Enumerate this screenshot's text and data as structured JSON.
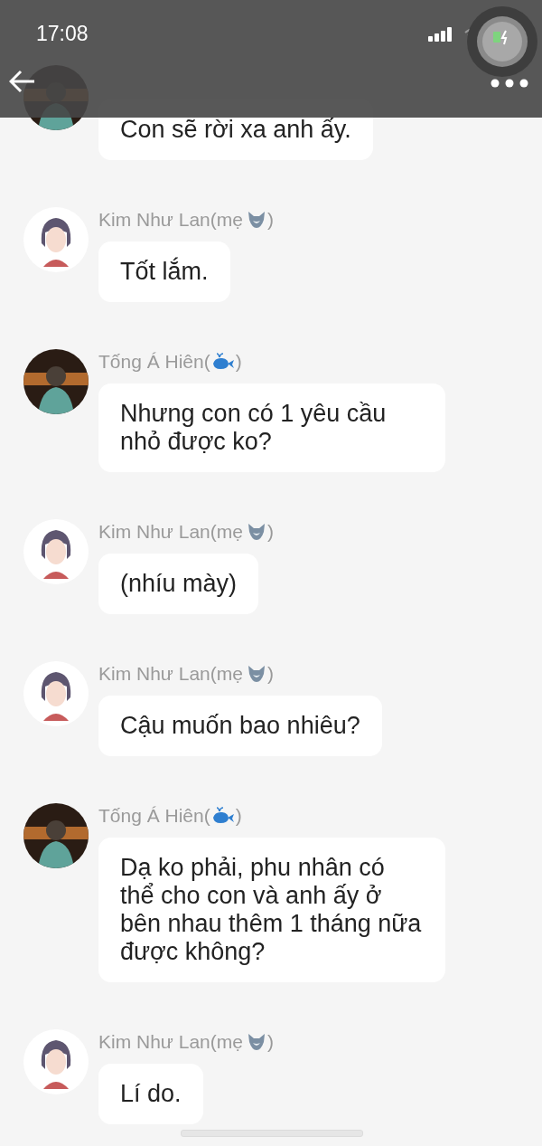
{
  "status_bar": {
    "time": "17:08"
  },
  "messages": [
    {
      "kind": "hien",
      "text": "Con sẽ rời xa anh ấy."
    },
    {
      "kind": "mom",
      "name": "Kim Như Lan(mẹ",
      "name_end": ")",
      "text": "Tốt lắm."
    },
    {
      "kind": "hien",
      "name": "Tống Á Hiên(",
      "name_end": ")",
      "text": "Nhưng con có 1 yêu cầu nhỏ được ko?"
    },
    {
      "kind": "mom",
      "name": "Kim Như Lan(mẹ",
      "name_end": ")",
      "text": "(nhíu mày)"
    },
    {
      "kind": "mom",
      "name": "Kim Như Lan(mẹ",
      "name_end": ")",
      "text": "Cậu muốn bao nhiêu?"
    },
    {
      "kind": "hien",
      "name": "Tống Á Hiên(",
      "name_end": ")",
      "text": "Dạ ko phải, phu nhân có thể cho con và anh ấy ở bên nhau thêm 1 tháng nữa được không?"
    },
    {
      "kind": "mom",
      "name": "Kim Như Lan(mẹ",
      "name_end": ")",
      "text": "Lí do."
    }
  ]
}
